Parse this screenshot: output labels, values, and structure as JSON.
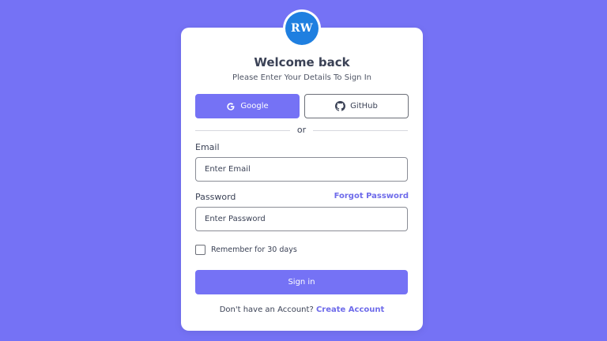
{
  "logo": {
    "text": "RW",
    "color": "#1f7fe0"
  },
  "header": {
    "title": "Welcome back",
    "subtitle": "Please Enter Your Details To Sign In"
  },
  "social": {
    "google_label": "Google",
    "google_icon": "google-icon",
    "github_label": "GitHub",
    "github_icon": "github-icon"
  },
  "divider": {
    "text": "or"
  },
  "email": {
    "label": "Email",
    "placeholder": "Enter Email",
    "value": ""
  },
  "password": {
    "label": "Password",
    "placeholder": "Enter Password",
    "value": "",
    "forgot_label": "Forgot Password"
  },
  "remember": {
    "label": "Remember for 30 days",
    "checked": false
  },
  "signin": {
    "label": "Sign in"
  },
  "footer": {
    "prompt": "Don't have an Account?",
    "link_label": "Create Account"
  },
  "colors": {
    "background": "#7572f5",
    "accent": "#7572f5",
    "link": "#6e6bea",
    "text": "#3b4256"
  }
}
